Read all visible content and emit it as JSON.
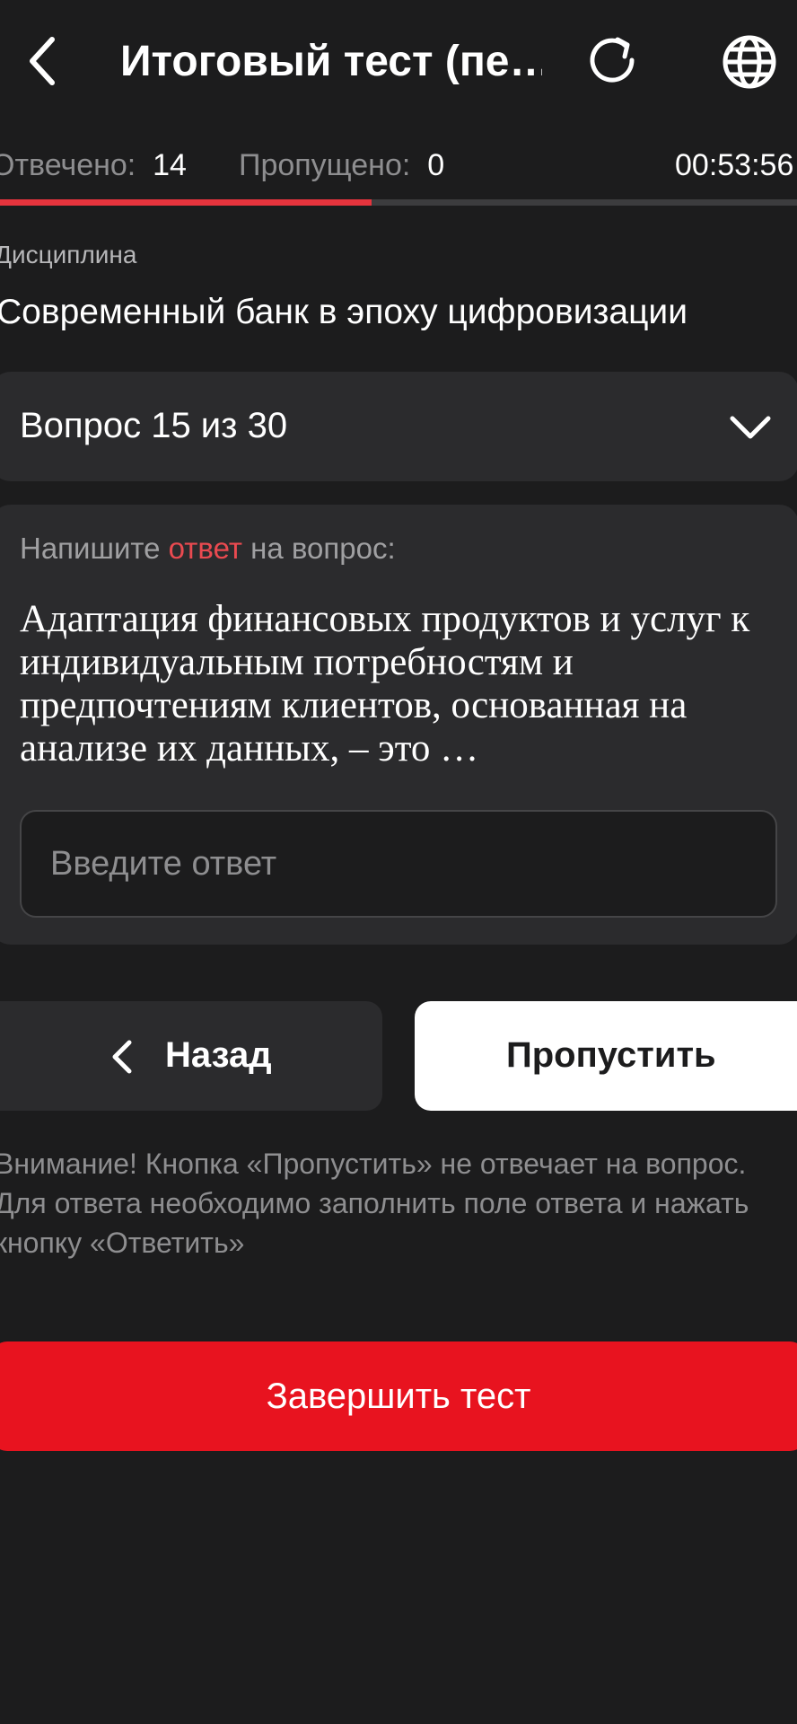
{
  "header": {
    "title": "Итоговый тест (пе…"
  },
  "stats": {
    "answered_label": "Отвечено:",
    "answered_value": "14",
    "skipped_label": "Пропущено:",
    "skipped_value": "0",
    "timer": "00:53:56"
  },
  "progress": {
    "fraction": 0.46667
  },
  "discipline": {
    "label": "Дисциплина",
    "name": "Современный банк в эпоху цифровизации"
  },
  "question_select": {
    "label": "Вопрос 15 из 30"
  },
  "question": {
    "prompt_before": "Напишите ",
    "prompt_accent": "ответ",
    "prompt_after": " на вопрос:",
    "text": "Адаптация финансовых продуктов и услуг к индивидуальным потребностям и предпочтениям клиентов, основанная на анализе их данных, – это …"
  },
  "answer": {
    "placeholder": "Введите ответ",
    "value": ""
  },
  "buttons": {
    "back": "Назад",
    "skip": "Пропустить",
    "finish": "Завершить тест"
  },
  "warning": "Внимание! Кнопка «Пропустить» не отвечает на вопрос. Для ответа необходимо заполнить поле ответа и нажать кнопку «Ответить»",
  "colors": {
    "background": "#1c1c1d",
    "accent_red": "#e8131f",
    "progress_red": "#e5343d"
  },
  "icons": [
    "chevron-left-icon",
    "reload-icon",
    "globe-icon",
    "chevron-down-icon"
  ]
}
